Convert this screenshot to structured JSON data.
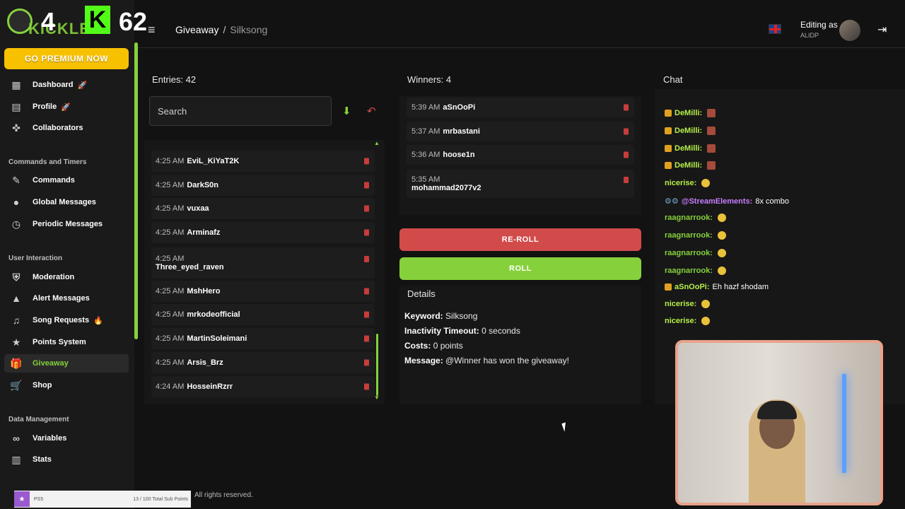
{
  "logo": {
    "count1": "4",
    "k": "K",
    "count2": "62",
    "brand": "KICKLET"
  },
  "sidebar": {
    "premium_label": "GO PREMIUM NOW",
    "top_items": [
      {
        "label": "Dashboard",
        "icon": "dashboard-icon",
        "emoji": "🚀"
      },
      {
        "label": "Profile",
        "icon": "profile-icon",
        "emoji": "🚀"
      },
      {
        "label": "Collaborators",
        "icon": "collaborators-icon"
      }
    ],
    "section_commands": "Commands and Timers",
    "commands_items": [
      {
        "label": "Commands",
        "icon": "wrench-icon"
      },
      {
        "label": "Global Messages",
        "icon": "chat-bubble-icon"
      },
      {
        "label": "Periodic Messages",
        "icon": "clock-icon"
      }
    ],
    "section_interaction": "User Interaction",
    "interaction_items": [
      {
        "label": "Moderation",
        "icon": "shield-icon"
      },
      {
        "label": "Alert Messages",
        "icon": "warning-icon"
      },
      {
        "label": "Song Requests",
        "icon": "music-icon",
        "emoji": "🔥"
      },
      {
        "label": "Points System",
        "icon": "star-icon"
      },
      {
        "label": "Giveaway",
        "icon": "gift-icon"
      },
      {
        "label": "Shop",
        "icon": "cart-icon"
      }
    ],
    "section_data": "Data Management",
    "data_items": [
      {
        "label": "Variables",
        "icon": "link-icon"
      },
      {
        "label": "Stats",
        "icon": "bar-chart-icon"
      }
    ]
  },
  "bottom_bar": {
    "left": "PS5",
    "right": "13 / 100 Total Sub Points"
  },
  "header": {
    "breadcrumb_root": "Giveaway",
    "breadcrumb_sep": "/",
    "breadcrumb_leaf": "Silksong",
    "editing_label": "Editing as",
    "editing_user": "ALIDP"
  },
  "entries": {
    "title": "Entries: 42",
    "search_placeholder": "Search",
    "rows": [
      {
        "time": "4:25 AM",
        "name": "EviL_KiYaT2K"
      },
      {
        "time": "4:25 AM",
        "name": "DarkS0n"
      },
      {
        "time": "4:25 AM",
        "name": "vuxaa"
      },
      {
        "time": "4:25 AM",
        "name": "Arminafz"
      },
      {
        "time": "4:25 AM",
        "name": "Three_eyed_raven"
      },
      {
        "time": "4:25 AM",
        "name": "MshHero"
      },
      {
        "time": "4:25 AM",
        "name": "mrkodeofficial"
      },
      {
        "time": "4:25 AM",
        "name": "MartinSoleimani"
      },
      {
        "time": "4:25 AM",
        "name": "Arsis_Brz"
      },
      {
        "time": "4:24 AM",
        "name": "HosseinRzrr"
      }
    ]
  },
  "winners": {
    "title": "Winners: 4",
    "rows": [
      {
        "time": "5:39 AM",
        "name": "aSnOoPi"
      },
      {
        "time": "5:37 AM",
        "name": "mrbastani"
      },
      {
        "time": "5:36 AM",
        "name": "hoose1n"
      },
      {
        "time": "5:35 AM",
        "name": "mohammad2077v2"
      }
    ]
  },
  "buttons": {
    "reroll": "RE-ROLL",
    "roll": "ROLL"
  },
  "details": {
    "title": "Details",
    "keyword_label": "Keyword:",
    "keyword": "Silksong",
    "inactivity_label": "Inactivity Timeout:",
    "inactivity": "0 seconds",
    "costs_label": "Costs:",
    "costs": "0 points",
    "message_label": "Message:",
    "message": "@Winner has won the giveaway!"
  },
  "chat": {
    "title": "Chat",
    "lines": [
      {
        "user": "DeMilli:",
        "color": "#b6f04a",
        "msg": ""
      },
      {
        "user": "DeMilli:",
        "color": "#b6f04a",
        "msg": ""
      },
      {
        "user": "DeMilli:",
        "color": "#b6f04a",
        "msg": ""
      },
      {
        "user": "DeMilli:",
        "color": "#b6f04a",
        "msg": ""
      },
      {
        "user": "nicerise:",
        "color": "#b6f04a",
        "msg": ""
      },
      {
        "user": "@StreamElements:",
        "color": "#c77dff",
        "msg": "8x combo"
      },
      {
        "user": "raagnarrook:",
        "color": "#86d13b",
        "msg": ""
      },
      {
        "user": "raagnarrook:",
        "color": "#86d13b",
        "msg": ""
      },
      {
        "user": "raagnarrook:",
        "color": "#86d13b",
        "msg": ""
      },
      {
        "user": "raagnarrook:",
        "color": "#86d13b",
        "msg": ""
      },
      {
        "user": "aSnOoPi:",
        "color": "#b6f04a",
        "msg": "Eh hazf shodam"
      },
      {
        "user": "nicerise:",
        "color": "#b6f04a",
        "msg": ""
      },
      {
        "user": "nicerise:",
        "color": "#b6f04a",
        "msg": ""
      }
    ]
  },
  "footer": {
    "text": "All rights reserved."
  }
}
